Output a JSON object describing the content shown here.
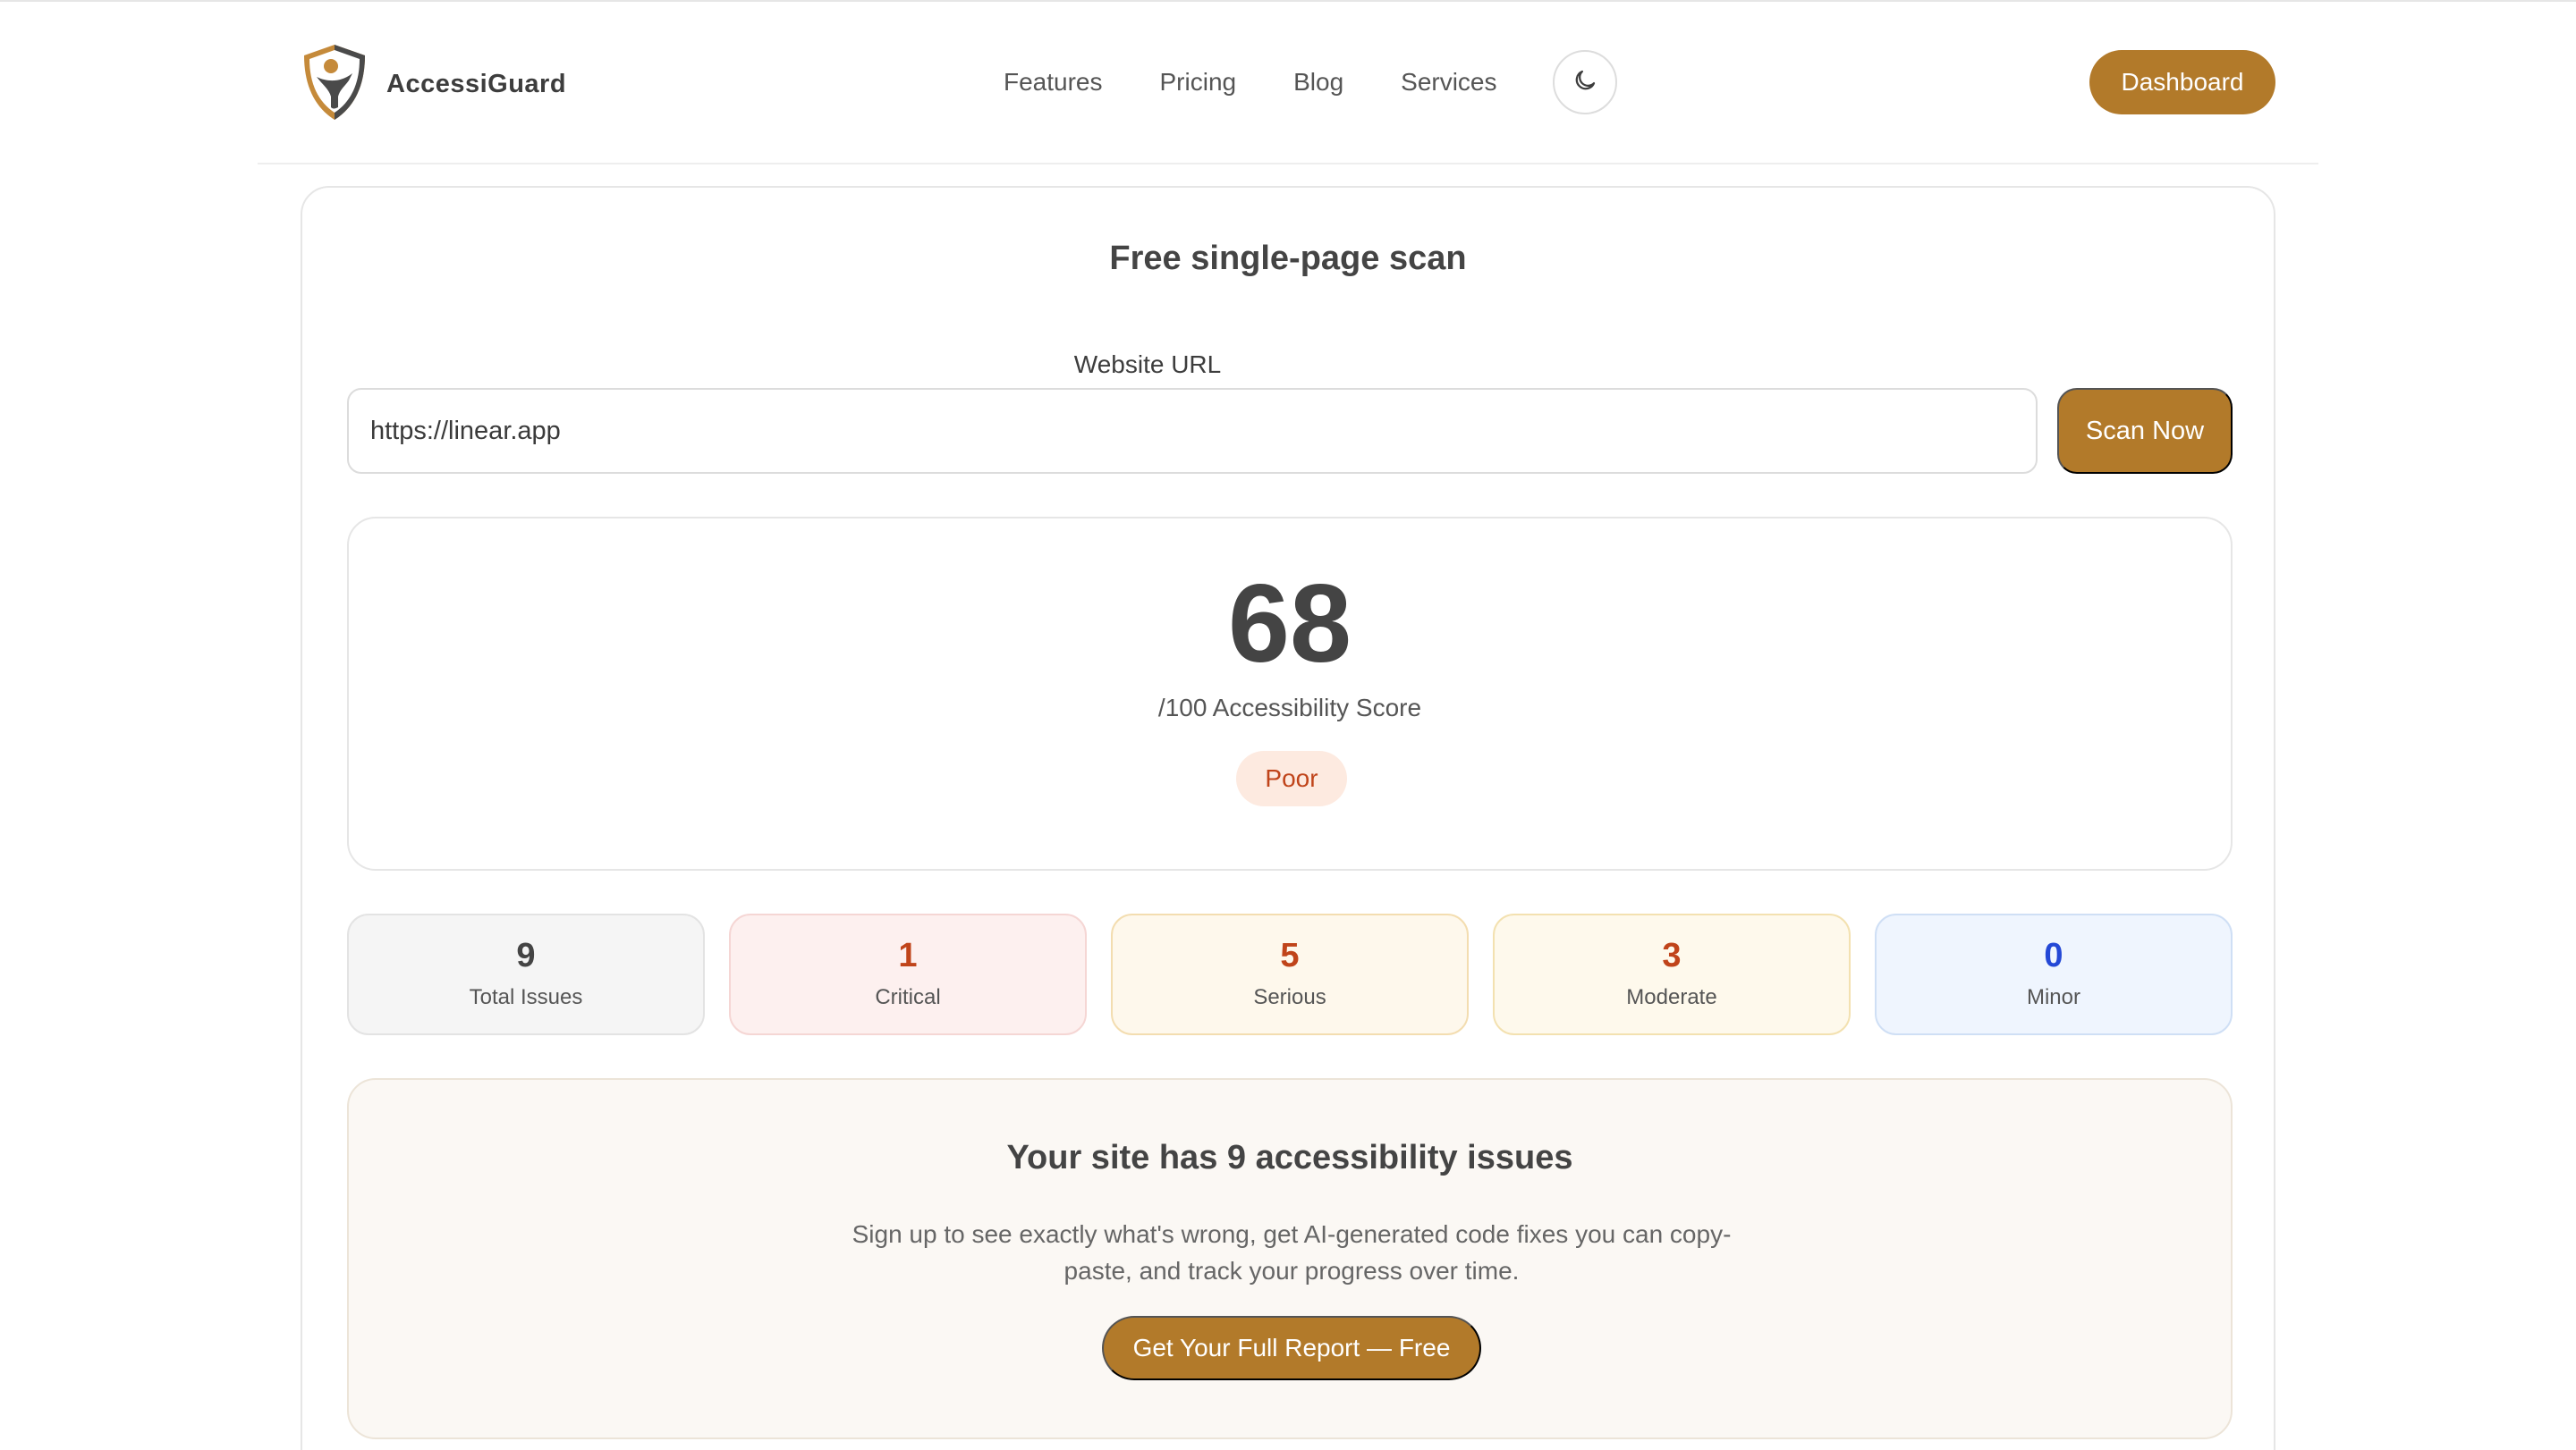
{
  "header": {
    "brand": "AccessiGuard",
    "logo_icon": "shield-person-icon",
    "nav": [
      {
        "label": "Features"
      },
      {
        "label": "Pricing"
      },
      {
        "label": "Blog"
      },
      {
        "label": "Services"
      }
    ],
    "theme_icon": "moon-icon",
    "dashboard_label": "Dashboard"
  },
  "scan": {
    "title": "Free single-page scan",
    "url_label": "Website URL",
    "url_value": "https://linear.app",
    "button_label": "Scan Now"
  },
  "score": {
    "value": "68",
    "label": "/100 Accessibility Score",
    "rating": "Poor"
  },
  "stats": [
    {
      "value": "9",
      "label": "Total Issues",
      "color": "#444444",
      "bg": "#f5f5f5",
      "border": "#e3e3e3"
    },
    {
      "value": "1",
      "label": "Critical",
      "color": "#c0441a",
      "bg": "#fdf0ef",
      "border": "#f5d6d4"
    },
    {
      "value": "5",
      "label": "Serious",
      "color": "#c0441a",
      "bg": "#fef8ec",
      "border": "#f3ddb0"
    },
    {
      "value": "3",
      "label": "Moderate",
      "color": "#c0441a",
      "bg": "#fef9ec",
      "border": "#f3e1b0"
    },
    {
      "value": "0",
      "label": "Minor",
      "color": "#2448d6",
      "bg": "#eff5fe",
      "border": "#cfdff5"
    }
  ],
  "cta": {
    "title": "Your site has 9 accessibility issues",
    "description": "Sign up to see exactly what's wrong, get AI-generated code fixes you can copy-paste, and track your progress over time.",
    "button_label": "Get Your Full Report — Free"
  },
  "colors": {
    "accent": "#b27a2a",
    "poor_badge_bg": "#fdeae0",
    "poor_badge_text": "#c0441a"
  }
}
